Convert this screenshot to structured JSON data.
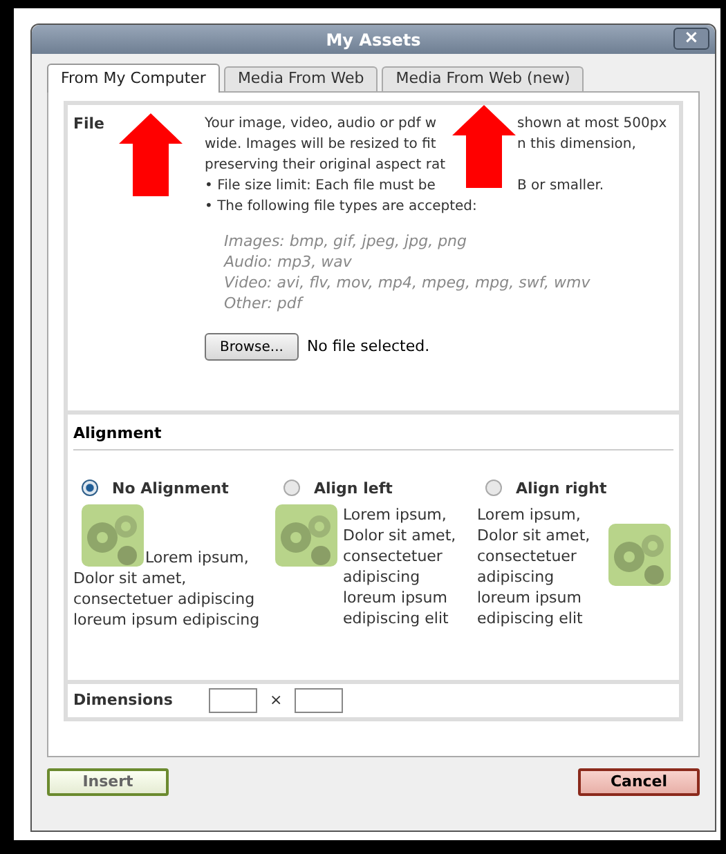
{
  "window": {
    "title": "My Assets",
    "close": "×"
  },
  "tabs": [
    {
      "label": "From My Computer",
      "selected": true
    },
    {
      "label": "Media From Web",
      "selected": false
    },
    {
      "label": "Media From Web (new)",
      "selected": false
    }
  ],
  "file": {
    "label": "File",
    "description_lines": [
      [
        "Your image, video, audio or pdf w",
        "shown at most 500px"
      ],
      [
        "wide. Images will be resized to fit ",
        "n this dimension,"
      ],
      [
        "preserving their original aspect rat"
      ],
      [
        "• File size limit: Each file must be ",
        "B or smaller."
      ],
      [
        "• The following file types are accepted:"
      ]
    ],
    "types": [
      "Images: bmp, gif, jpeg, jpg, png",
      "Audio: mp3, wav",
      "Video: avi, flv, mov, mp4, mpeg, mpg, swf, wmv",
      "Other: pdf"
    ],
    "browse": "Browse...",
    "status": "No file selected."
  },
  "alignment": {
    "label": "Alignment",
    "options": [
      {
        "kind": "none",
        "label": "No Alignment",
        "selected": true,
        "text": "Lorem ipsum, Dolor sit amet, consectetuer adipiscing loreum ipsum edipiscing"
      },
      {
        "kind": "left",
        "label": "Align left",
        "selected": false,
        "text": "Lorem ipsum, Dolor sit amet, consectetuer adipiscing loreum ipsum edipiscing elit"
      },
      {
        "kind": "right",
        "label": "Align right",
        "selected": false,
        "text": "Lorem ipsum, Dolor sit amet, consectetuer adipiscing loreum ipsum edipiscing elit"
      }
    ]
  },
  "dimensions": {
    "label": "Dimensions",
    "separator": "×"
  },
  "buttons": {
    "insert": "Insert",
    "cancel": "Cancel"
  }
}
